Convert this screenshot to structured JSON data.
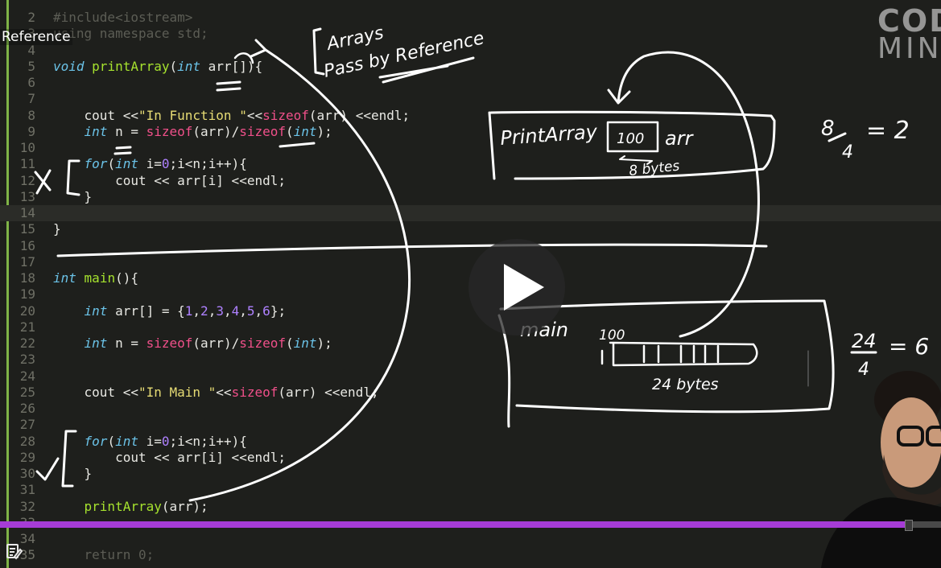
{
  "overlay": {
    "title": "Reference"
  },
  "logo": {
    "line1": "COD",
    "line2": "MIN"
  },
  "editor": {
    "current_line": "14",
    "lines": [
      {
        "n": "2",
        "t": "#include<iostream>"
      },
      {
        "n": "3",
        "t": "using namespace std;"
      },
      {
        "n": "4",
        "t": ""
      },
      {
        "n": "5",
        "t": "void printArray(int arr[]){"
      },
      {
        "n": "6",
        "t": ""
      },
      {
        "n": "7",
        "t": ""
      },
      {
        "n": "8",
        "t": "    cout <<\"In Function \"<<sizeof(arr) <<endl;"
      },
      {
        "n": "9",
        "t": "    int n = sizeof(arr)/sizeof(int);"
      },
      {
        "n": "10",
        "t": ""
      },
      {
        "n": "11",
        "t": "    for(int i=0;i<n;i++){"
      },
      {
        "n": "12",
        "t": "        cout << arr[i] <<endl;"
      },
      {
        "n": "13",
        "t": "    }"
      },
      {
        "n": "14",
        "t": ""
      },
      {
        "n": "15",
        "t": "}"
      },
      {
        "n": "16",
        "t": ""
      },
      {
        "n": "17",
        "t": ""
      },
      {
        "n": "18",
        "t": "int main(){"
      },
      {
        "n": "19",
        "t": ""
      },
      {
        "n": "20",
        "t": "    int arr[] = {1,2,3,4,5,6};"
      },
      {
        "n": "21",
        "t": ""
      },
      {
        "n": "22",
        "t": "    int n = sizeof(arr)/sizeof(int);"
      },
      {
        "n": "23",
        "t": ""
      },
      {
        "n": "24",
        "t": ""
      },
      {
        "n": "25",
        "t": "    cout <<\"In Main \"<<sizeof(arr) <<endl;"
      },
      {
        "n": "26",
        "t": ""
      },
      {
        "n": "27",
        "t": ""
      },
      {
        "n": "28",
        "t": "    for(int i=0;i<n;i++){"
      },
      {
        "n": "29",
        "t": "        cout << arr[i] <<endl;"
      },
      {
        "n": "30",
        "t": "    }"
      },
      {
        "n": "31",
        "t": ""
      },
      {
        "n": "32",
        "t": "    printArray(arr);"
      },
      {
        "n": "33",
        "t": ""
      },
      {
        "n": "34",
        "t": ""
      },
      {
        "n": "35",
        "t": "    return 0;"
      }
    ]
  },
  "annotations": {
    "arrays": "Arrays",
    "pass_by_reference": "Pass by Reference",
    "print_array": "PrintArray",
    "ptr_value": "100",
    "arr_label": "arr",
    "eight_bytes": "8 bytes",
    "main_label": "main",
    "main_addr": "100",
    "twenty_four_bytes": "24 bytes",
    "eq1_num": "8",
    "eq1_den": "4",
    "eq1_res": "= 2",
    "eq2_num": "24",
    "eq2_den": "4",
    "eq2_res": "= 6",
    "cross": "X",
    "tick": "✓"
  },
  "player": {
    "progress_fraction": 0.965
  },
  "colors": {
    "accent": "#7fb347",
    "progress": "#a63cd6",
    "ink": "#ffffff"
  }
}
